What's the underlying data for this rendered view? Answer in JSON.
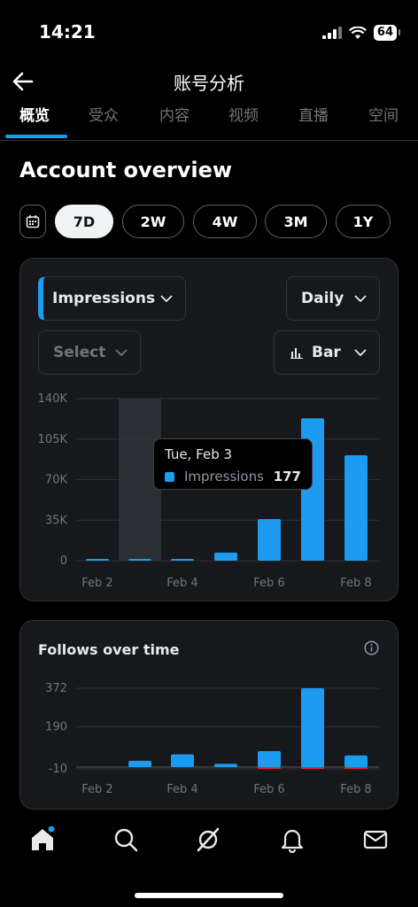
{
  "status": {
    "time": "14:21",
    "battery": "64"
  },
  "header": {
    "title": "账号分析"
  },
  "tabs": [
    {
      "label": "概览",
      "active": true
    },
    {
      "label": "受众"
    },
    {
      "label": "内容"
    },
    {
      "label": "视频"
    },
    {
      "label": "直播"
    },
    {
      "label": "空间"
    }
  ],
  "overview": {
    "title": "Account overview"
  },
  "periods": [
    "7D",
    "2W",
    "4W",
    "3M",
    "1Y"
  ],
  "active_period": "7D",
  "impressions_card": {
    "metric": "Impressions",
    "granularity": "Daily",
    "compare_placeholder": "Select",
    "chart_type_label": "Bar",
    "tooltip": {
      "date": "Tue, Feb 3",
      "series": "Impressions",
      "value": "177"
    },
    "accent_color": "#1d9bf0"
  },
  "follows_card": {
    "title": "Follows over time"
  },
  "colors": {
    "accent": "#1d9bf0",
    "negative": "#f4212e",
    "background": "#000000",
    "card": "#16181c"
  },
  "bottom_nav": [
    "home-icon",
    "search-icon",
    "grok-icon",
    "notifications-icon",
    "messages-icon"
  ],
  "chart_data": [
    {
      "type": "bar",
      "categories": [
        "Feb 2",
        "Feb 3",
        "Feb 4",
        "Feb 5",
        "Feb 6",
        "Feb 7",
        "Feb 8"
      ],
      "x_tick_labels": [
        "Feb 2",
        "Feb 4",
        "Feb 6",
        "Feb 8"
      ],
      "y_tick_labels": [
        "140K",
        "105K",
        "70K",
        "35K",
        "0"
      ],
      "series": [
        {
          "name": "Impressions",
          "values": [
            900,
            177,
            1200,
            7000,
            36000,
            123000,
            91000
          ]
        }
      ],
      "ylim": [
        0,
        140000
      ],
      "highlighted_category": "Feb 3",
      "grid": true
    },
    {
      "type": "bar",
      "title": "Follows over time",
      "categories": [
        "Feb 2",
        "Feb 3",
        "Feb 4",
        "Feb 5",
        "Feb 6",
        "Feb 7",
        "Feb 8"
      ],
      "x_tick_labels": [
        "Feb 2",
        "Feb 4",
        "Feb 6",
        "Feb 8"
      ],
      "y_tick_labels": [
        "372",
        "190",
        "-10"
      ],
      "series": [
        {
          "values": [
            0,
            30,
            60,
            15,
            75,
            372,
            55
          ]
        },
        {
          "values": [
            0,
            0,
            0,
            0,
            -2,
            -8,
            -8
          ]
        }
      ],
      "ylim": [
        -10,
        372
      ],
      "grid": true
    }
  ]
}
